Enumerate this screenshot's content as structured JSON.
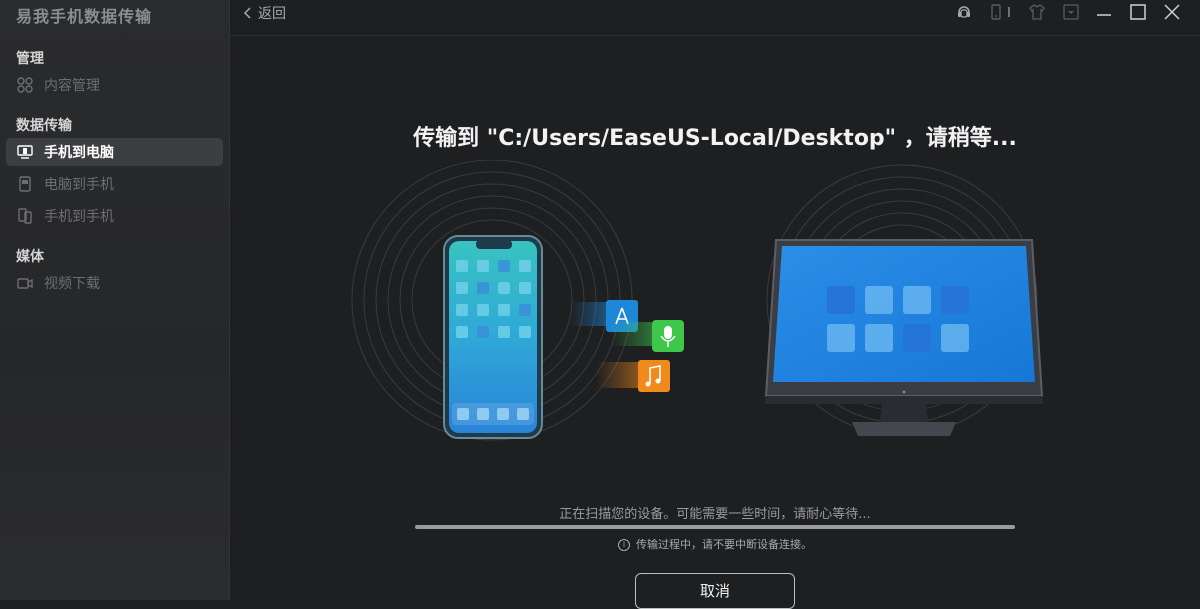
{
  "app": {
    "title": "易我手机数据传输"
  },
  "sidebar": {
    "sections": [
      {
        "title": "管理",
        "items": [
          {
            "label": "内容管理",
            "icon": "grid-icon",
            "active": false
          }
        ]
      },
      {
        "title": "数据传输",
        "items": [
          {
            "label": "手机到电脑",
            "icon": "phone-to-pc-icon",
            "active": true
          },
          {
            "label": "电脑到手机",
            "icon": "pc-to-phone-icon",
            "active": false
          },
          {
            "label": "手机到手机",
            "icon": "phone-to-phone-icon",
            "active": false
          }
        ]
      },
      {
        "title": "媒体",
        "items": [
          {
            "label": "视频下载",
            "icon": "video-icon",
            "active": false
          }
        ]
      }
    ]
  },
  "topbar": {
    "back_label": "返回",
    "icons": [
      "support-icon",
      "device-icon",
      "shirt-icon",
      "menu-dropdown-icon",
      "minimize-icon",
      "maximize-icon",
      "close-icon"
    ]
  },
  "main": {
    "title": "传输到 \"C:/Users/EaseUS-Local/Desktop\" ，请稍等...",
    "status": "正在扫描您的设备。可能需要一些时间，请耐心等待...",
    "progress": 1.0,
    "hint": "传输过程中，请不要中断设备连接。",
    "cancel_label": "取消"
  },
  "colors": {
    "background": "#1e1f21",
    "sidebar": "#2a2b2d",
    "active_item": "#3d3e41",
    "screen_blue": "#2e8ae6",
    "app_blue": "#1e88d8",
    "app_green": "#3ec74a",
    "app_orange": "#f08a1c"
  }
}
